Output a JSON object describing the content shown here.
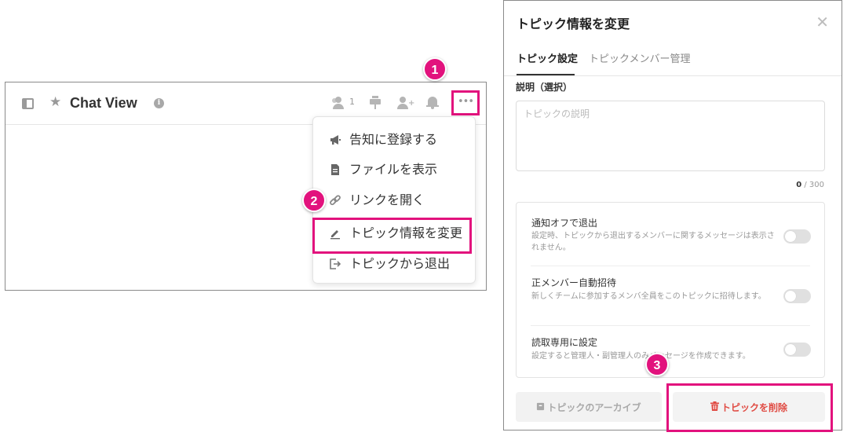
{
  "chat": {
    "title": "Chat View",
    "member_count": "1",
    "more_label": "•••"
  },
  "menu": {
    "items": [
      {
        "icon": "megaphone-icon",
        "label": "告知に登録する"
      },
      {
        "icon": "file-icon",
        "label": "ファイルを表示"
      },
      {
        "icon": "link-icon",
        "label": "リンクを開く"
      },
      {
        "icon": "edit-icon",
        "label": "トピック情報を変更"
      },
      {
        "icon": "exit-icon",
        "label": "トピックから退出"
      }
    ]
  },
  "dialog": {
    "title": "トピック情報を変更",
    "tabs": [
      {
        "label": "トピック設定",
        "active": true
      },
      {
        "label": "トピックメンバー管理",
        "active": false
      }
    ],
    "description": {
      "label": "説明（選択）",
      "placeholder": "トピックの説明",
      "value": "",
      "count_current": "0",
      "count_max": " / 300"
    },
    "settings": [
      {
        "title": "通知オフで退出",
        "desc": "設定時、トピックから退出するメンバーに関するメッセージは表示されません。",
        "enabled": false
      },
      {
        "title": "正メンバー自動招待",
        "desc": "新しくチームに参加するメンバ全員をこのトピックに招待します。",
        "enabled": false
      },
      {
        "title": "読取専用に設定",
        "desc": "設定すると管理人・副管理人のみメッセージを作成できます。",
        "enabled": false
      }
    ],
    "archive_label": "トピックのアーカイブ",
    "delete_label": "トピックを削除"
  },
  "badges": [
    "1",
    "2",
    "3"
  ],
  "colors": {
    "highlight": "#e2127d",
    "danger": "#e04b43"
  }
}
